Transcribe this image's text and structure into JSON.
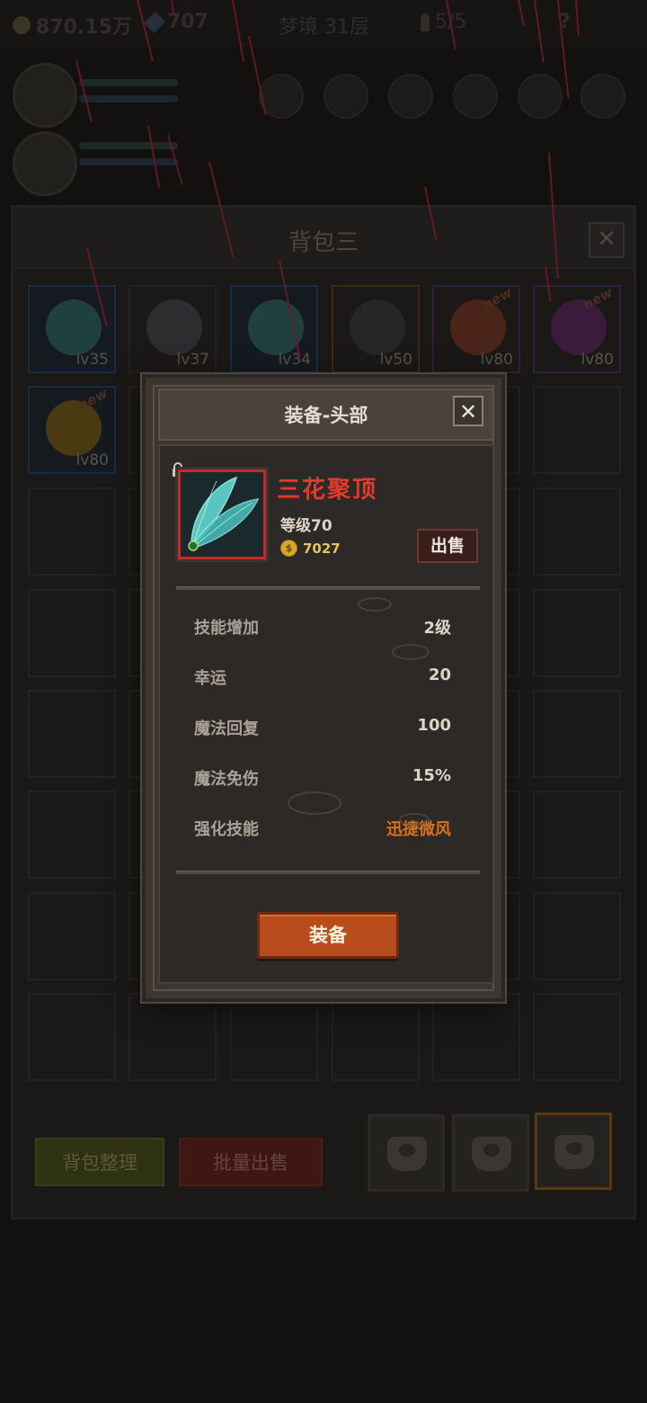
{
  "top_bar": {
    "gold": "870.15万",
    "gems": "707",
    "stage": "梦境 31层",
    "keys": "5/5"
  },
  "backpack": {
    "title": "背包三",
    "close_icon": "close-icon",
    "slots": [
      {
        "level": "lv35",
        "rarity": "blue",
        "icon": "net-helmet-icon",
        "new": false
      },
      {
        "level": "lv37",
        "rarity": "gray",
        "icon": "knight-helmet-icon",
        "new": false
      },
      {
        "level": "lv34",
        "rarity": "blue",
        "icon": "net-helmet-icon",
        "new": false
      },
      {
        "level": "lv50",
        "rarity": "orange",
        "icon": "dark-helmet-icon",
        "new": false
      },
      {
        "level": "lv80",
        "rarity": "purple",
        "icon": "shield-icon",
        "new": true
      },
      {
        "level": "lv80",
        "rarity": "purple",
        "icon": "armor-icon",
        "new": true
      },
      {
        "level": "lv80",
        "rarity": "blue",
        "icon": "ring-icon",
        "new": true
      }
    ],
    "new_label": "new",
    "sort_button": "背包整理",
    "bulk_sell_button": "批量出售"
  },
  "modal": {
    "title": "装备-头部",
    "item_name": "三花聚顶",
    "item_level": "等级70",
    "item_price": "7027",
    "sell_button": "出售",
    "stats": [
      {
        "label": "技能增加",
        "value": "2级"
      },
      {
        "label": "幸运",
        "value": "20"
      },
      {
        "label": "魔法回复",
        "value": "100"
      },
      {
        "label": "魔法免伤",
        "value": "15%"
      },
      {
        "label": "强化技能",
        "value": "迅捷微风"
      }
    ],
    "equip_button": "装备"
  },
  "colors": {
    "item_name": "#e23a2c",
    "skill_highlight": "#d8701f",
    "equip_button": "#b84c1c",
    "rain": "#6b1826"
  }
}
